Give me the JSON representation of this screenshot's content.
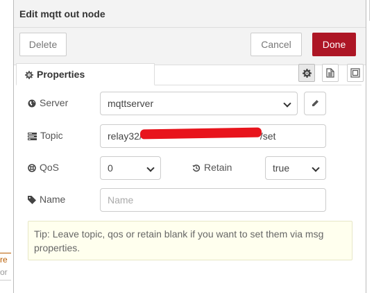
{
  "background": {
    "node_label_line1": "re",
    "node_label_line2": "or"
  },
  "tray": {
    "title": "Edit mqtt out node",
    "toolbar": {
      "delete_label": "Delete",
      "cancel_label": "Cancel",
      "done_label": "Done"
    },
    "tabs": {
      "properties_label": "Properties",
      "icon_tabs": [
        "gear-icon",
        "document-icon",
        "frame-icon"
      ]
    },
    "form": {
      "server": {
        "label": "Server",
        "value": "mqttserver"
      },
      "topic": {
        "label": "Topic",
        "value_prefix": "relay32/",
        "value_suffix": "/set"
      },
      "qos": {
        "label": "QoS",
        "value": "0"
      },
      "retain": {
        "label": "Retain",
        "value": "true"
      },
      "name": {
        "label": "Name",
        "placeholder": "Name",
        "value": ""
      }
    },
    "tip": "Tip: Leave topic, qos or retain blank if you want to set them via msg properties."
  },
  "colors": {
    "done_button": "#ad1625",
    "redaction": "#e8141c",
    "tip_background": "#ffffee"
  }
}
